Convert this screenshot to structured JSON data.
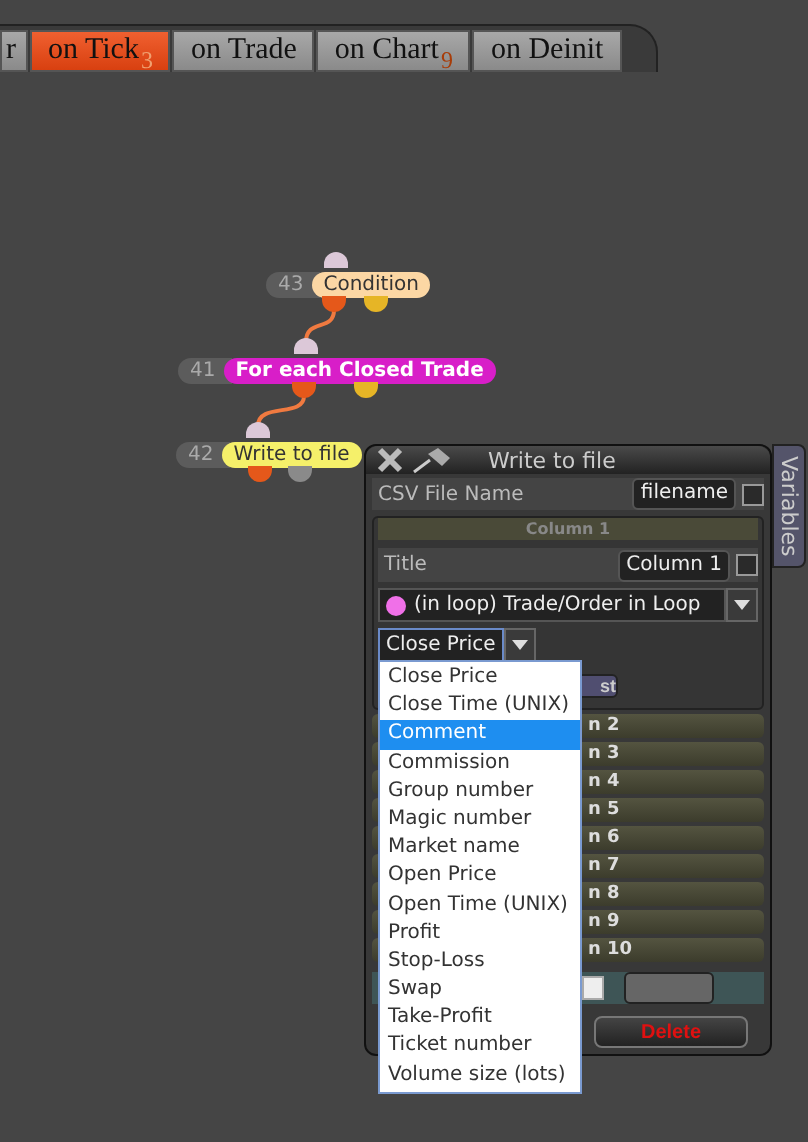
{
  "tabs": [
    {
      "label": "r",
      "selected": false
    },
    {
      "label": "on Tick",
      "badge": "3",
      "selected": true
    },
    {
      "label": "on Trade",
      "selected": false
    },
    {
      "label": "on Chart",
      "badge": "9",
      "selected": false
    },
    {
      "label": "on Deinit",
      "selected": false
    }
  ],
  "nodes": [
    {
      "number": "43",
      "label": "Condition",
      "color": "#fcd7a4",
      "outputs": [
        {
          "color": "#e5581a"
        },
        {
          "color": "#e6b526"
        }
      ]
    },
    {
      "number": "41",
      "label": "For each Closed Trade",
      "color": "#d81ec8",
      "outputs": [
        {
          "color": "#e5581a"
        },
        {
          "color": "#e6b526"
        }
      ]
    },
    {
      "number": "42",
      "label": "Write to file",
      "color": "#f5f06a",
      "outputs": [
        {
          "color": "#e5581a"
        },
        {
          "color": "#8a8a8a"
        }
      ]
    }
  ],
  "panel": {
    "title": "Write to file",
    "side_tab": "Variables",
    "file_field": {
      "label": "CSV File Name",
      "value": "filename",
      "checked": false
    },
    "column_header": "Column 1",
    "title_field": {
      "label": "Title",
      "value": "Column 1",
      "checked": false
    },
    "source_select": {
      "value": "(in loop) Trade/Order in Loop",
      "color": "#f070e8"
    },
    "field_select": {
      "value": "Close Price"
    },
    "button_fragment": "st",
    "column_rows": [
      "n 2",
      "n 3",
      "n 4",
      "n 5",
      "n 6",
      "n 7",
      "n 8",
      "n 9",
      "n 10"
    ],
    "bottom_checkbox": {
      "checked": false
    },
    "delete_button": "Delete"
  },
  "dropdown": {
    "options": [
      {
        "label": "Close Price",
        "selected": false
      },
      {
        "label": "Close Time (UNIX)",
        "selected": false
      },
      {
        "label": "Comment",
        "selected": true
      },
      {
        "label": "Commission",
        "selected": false
      },
      {
        "label": "Group number",
        "selected": false
      },
      {
        "label": "Magic number",
        "selected": false
      },
      {
        "label": "Market name",
        "selected": false
      },
      {
        "label": "Open Price",
        "selected": false
      },
      {
        "label": "Open Time (UNIX)",
        "selected": false
      },
      {
        "label": "Profit",
        "selected": false
      },
      {
        "label": "Stop-Loss",
        "selected": false
      },
      {
        "label": "Swap",
        "selected": false
      },
      {
        "label": "Take-Profit",
        "selected": false
      },
      {
        "label": "Ticket number",
        "selected": false
      },
      {
        "label": "Volume size (lots)",
        "selected": false
      }
    ]
  }
}
